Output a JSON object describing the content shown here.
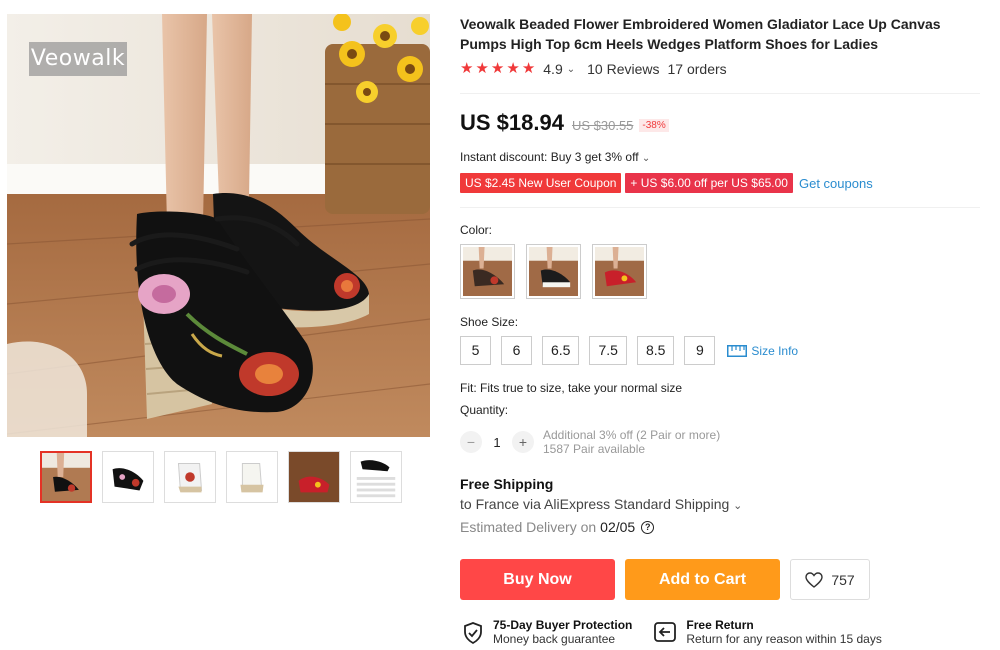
{
  "brand": {
    "watermark": "Veowalk"
  },
  "product": {
    "title": "Veowalk Beaded Flower Embroidered Women Gladiator Lace Up Canvas Pumps High Top 6cm Heels Wedges Platform Shoes for Ladies",
    "rating": "4.9",
    "stars_filled": 5,
    "reviews": "10 Reviews",
    "orders": "17 orders"
  },
  "pricing": {
    "current": "US $18.94",
    "original": "US $30.55",
    "discount": "-38%",
    "instant_discount": "Instant discount: Buy 3 get 3% off",
    "coupons": [
      "US $2.45 New User Coupon",
      "+ US $6.00 off per US $65.00"
    ],
    "get_coupons": "Get coupons"
  },
  "options": {
    "color_label": "Color:",
    "colors": [
      {
        "name": "black-floral",
        "accent": "#3a2a22"
      },
      {
        "name": "beige-floral",
        "accent": "#1c1c1c"
      },
      {
        "name": "red-floral",
        "accent": "#c8202a"
      }
    ],
    "size_label": "Shoe Size:",
    "sizes": [
      "5",
      "6",
      "6.5",
      "7.5",
      "8.5",
      "9"
    ],
    "size_info": "Size Info",
    "fit": "Fit: Fits true to size, take your normal size"
  },
  "quantity": {
    "label": "Quantity:",
    "value": "1",
    "minus": "−",
    "plus": "+",
    "note1": "Additional 3% off (2 Pair or more)",
    "note2": "1587 Pair available"
  },
  "shipping": {
    "title": "Free Shipping",
    "destination": "to France via AliExpress Standard Shipping",
    "estimated_label": "Estimated Delivery on",
    "estimated_date": "02/05",
    "help": "?"
  },
  "actions": {
    "buy_now": "Buy Now",
    "add_to_cart": "Add to Cart",
    "wishlist_count": "757"
  },
  "guarantees": [
    {
      "title": "75-Day Buyer Protection",
      "subtitle": "Money back guarantee"
    },
    {
      "title": "Free Return",
      "subtitle": "Return for any reason within 15 days"
    }
  ],
  "colors": {
    "accent_red": "#ff4747",
    "accent_orange": "#ff9a1a",
    "link_blue": "#2a8ccf",
    "star_red": "#f0393a"
  }
}
